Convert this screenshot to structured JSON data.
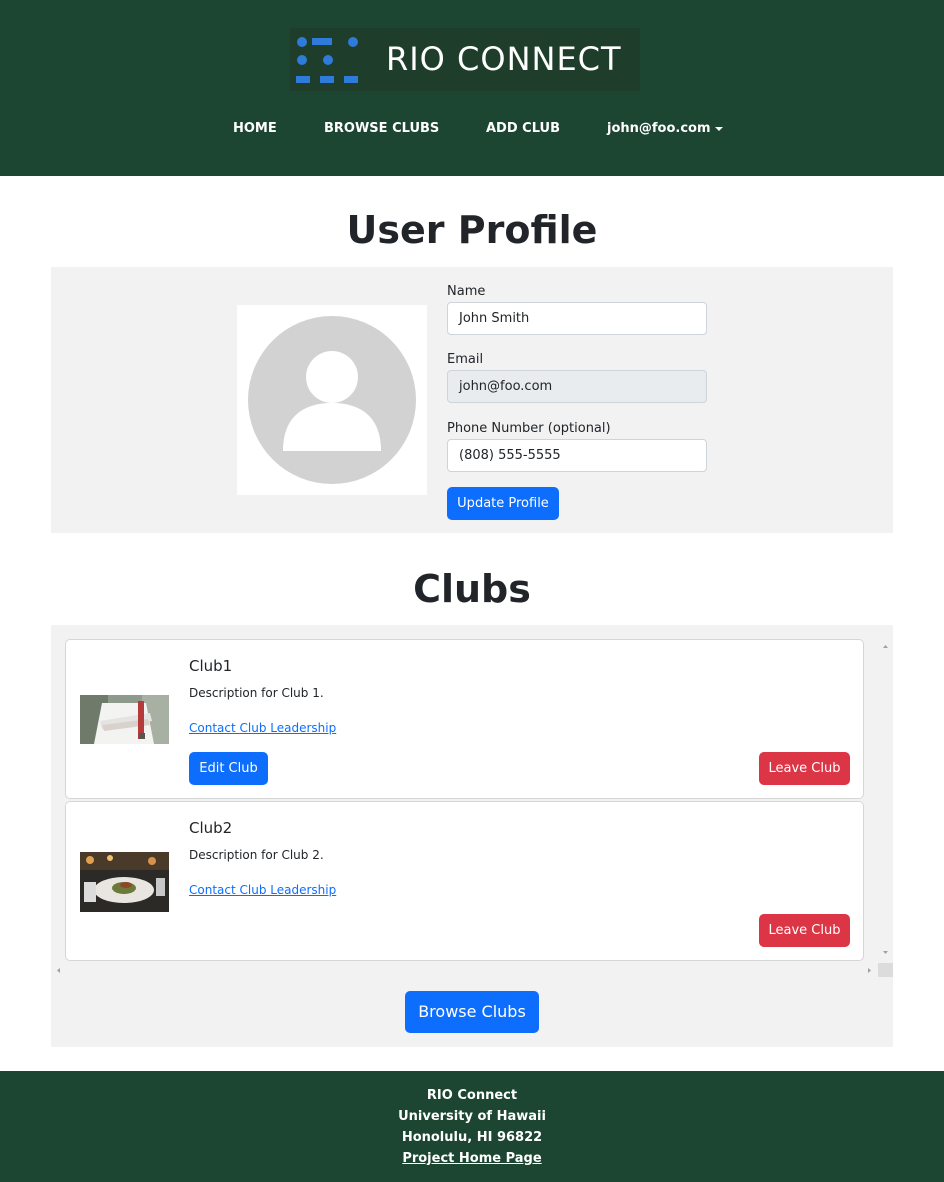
{
  "header": {
    "logo_text": "RIO CONNECT",
    "nav": {
      "home": "HOME",
      "browse_clubs": "BROWSE CLUBS",
      "add_club": "ADD CLUB",
      "user_menu": "john@foo.com"
    }
  },
  "profile": {
    "heading": "User Profile",
    "avatar_icon": "user-placeholder-icon",
    "name_label": "Name",
    "name_value": "John Smith",
    "email_label": "Email",
    "email_value": "john@foo.com",
    "phone_label": "Phone Number (optional)",
    "phone_value": "(808) 555-5555",
    "update_button": "Update Profile"
  },
  "clubs": {
    "heading": "Clubs",
    "items": [
      {
        "title": "Club1",
        "description": "Description for Club 1.",
        "contact_link": "Contact Club Leadership",
        "edit_button": "Edit Club",
        "leave_button": "Leave Club",
        "thumbnail": "chef-photo"
      },
      {
        "title": "Club2",
        "description": "Description for Club 2.",
        "contact_link": "Contact Club Leadership",
        "leave_button": "Leave Club",
        "thumbnail": "restaurant-dish-photo"
      }
    ],
    "browse_button": "Browse Clubs"
  },
  "footer": {
    "line1": "RIO Connect",
    "line2": "University of Hawaii",
    "line3": "Honolulu, HI 96822",
    "link": "Project Home Page"
  },
  "colors": {
    "header_bg": "#1c4532",
    "primary": "#0d6efd",
    "danger": "#dc3545",
    "panel_bg": "#f2f2f2"
  }
}
